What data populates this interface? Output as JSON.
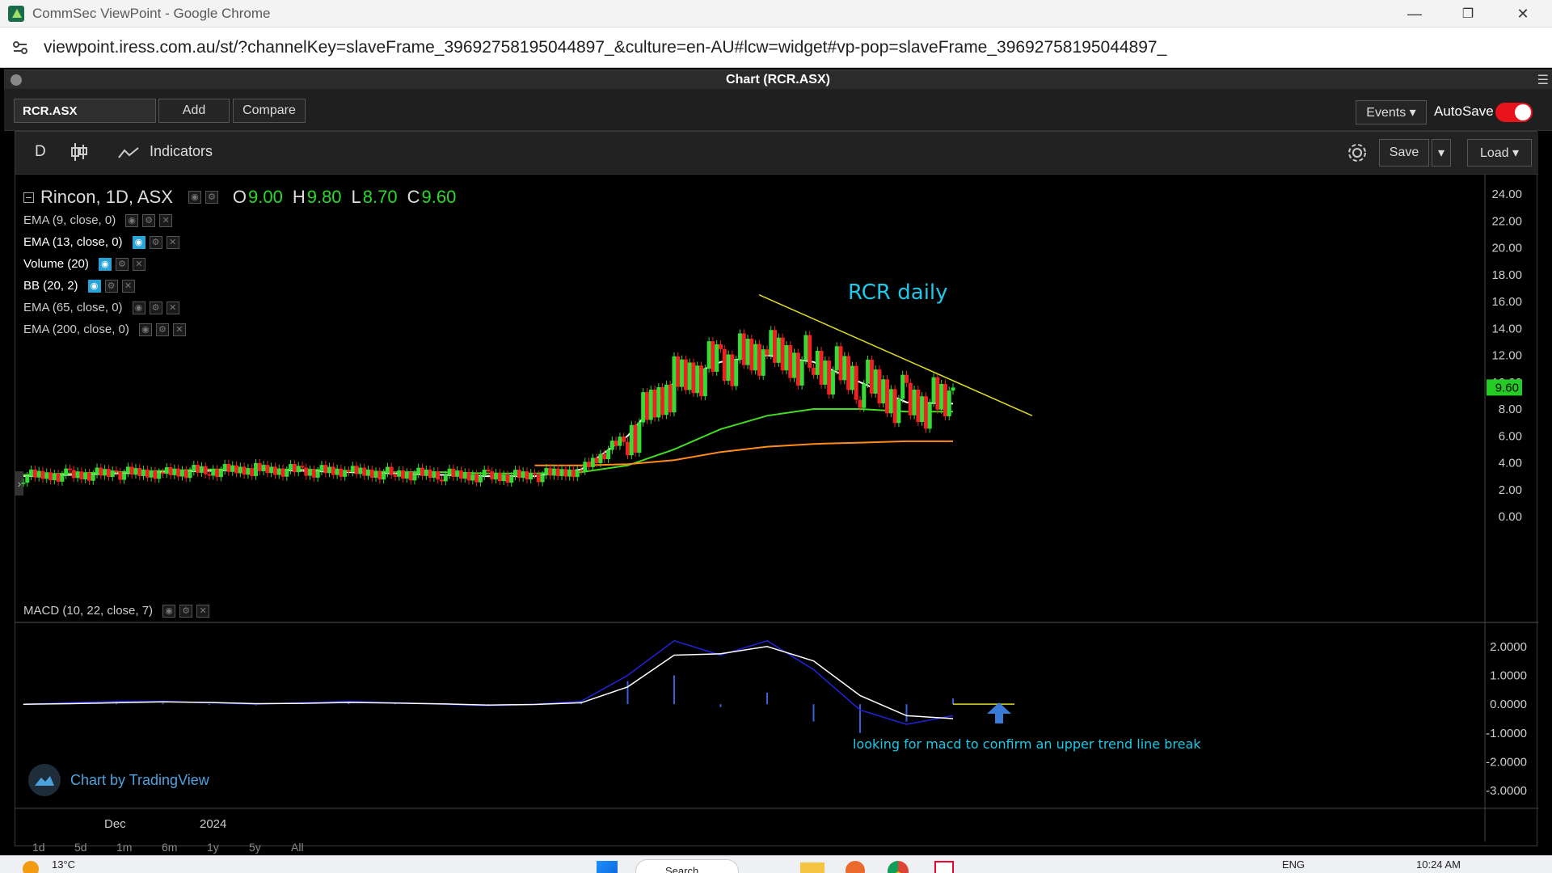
{
  "browser": {
    "window_title": "CommSec ViewPoint - Google Chrome",
    "url": "viewpoint.iress.com.au/st/?channelKey=slaveFrame_39692758195044897_&culture=en-AU#lcw=widget#vp-pop=slaveFrame_39692758195044897_",
    "minimize_glyph": "—",
    "restore_glyph": "❐",
    "close_glyph": "✕"
  },
  "panel": {
    "title": "Chart (RCR.ASX)"
  },
  "toolbar": {
    "symbol": "RCR.ASX",
    "add_label": "Add",
    "compare_label": "Compare",
    "events_label": "Events ▾",
    "autosave_label": "AutoSave",
    "autosave_on": true
  },
  "chart_toolbar": {
    "interval": "D",
    "indicators_label": "Indicators",
    "save_label": "Save",
    "save_dropdown": "▾",
    "load_label": "Load ▾"
  },
  "legend": {
    "main": "Rincon, 1D, ASX",
    "o_key": "O",
    "o_val": "9.00",
    "h_key": "H",
    "h_val": "9.80",
    "l_key": "L",
    "l_val": "8.70",
    "c_key": "C",
    "c_val": "9.60",
    "studies": [
      "EMA (9, close, 0)",
      "EMA (13, close, 0)",
      "Volume (20)",
      "BB (20, 2)",
      "EMA (65, close, 0)",
      "EMA (200, close, 0)"
    ],
    "macd": "MACD (10, 22, close, 7)"
  },
  "annotations": {
    "title": "RCR daily",
    "note": "looking for macd to confirm an upper trend line break",
    "watermark": "Chart by TradingView"
  },
  "price_axis": {
    "labels": [
      "24.00",
      "22.00",
      "20.00",
      "18.00",
      "16.00",
      "14.00",
      "12.00",
      "10.00",
      "8.00",
      "6.00",
      "4.00",
      "2.00",
      "0.00"
    ],
    "last_price": "9.60"
  },
  "macd_axis": {
    "labels": [
      "2.0000",
      "1.0000",
      "0.0000",
      "-1.0000",
      "-2.0000",
      "-3.0000"
    ]
  },
  "time_axis": {
    "labels": [
      "Dec",
      "2024"
    ]
  },
  "ranges": [
    "1d",
    "5d",
    "1m",
    "6m",
    "1y",
    "5y",
    "All"
  ],
  "colors": {
    "up": "#33dd33",
    "down": "#ee2222",
    "ema_fast": "#ffffff",
    "ema_mid": "#44dd22",
    "ema_slow": "#ff8c1a",
    "trendline": "#dddd22",
    "macd_line": "#2222dd",
    "signal_line": "#ffffff",
    "annotation": "#1ec8e6"
  },
  "chart_data": {
    "type": "line",
    "symbol": "Rincon, 1D, ASX",
    "ylim": [
      0,
      24
    ],
    "ohlc_last": {
      "open": 9.0,
      "high": 9.8,
      "low": 8.7,
      "close": 9.6
    },
    "series": [
      {
        "name": "EMA (9, close, 0)",
        "values": [
          3.0,
          3.1,
          3.2,
          3.3,
          3.4,
          3.5,
          3.4,
          3.3,
          3.2,
          3.1,
          3.0,
          3.0,
          3.5,
          6.0,
          10.0,
          11.5,
          12.0,
          11.5,
          10.0,
          8.5,
          8.4
        ]
      },
      {
        "name": "EMA (65, close, 0)",
        "values": [
          3.1,
          3.2,
          3.3,
          3.4,
          3.5,
          3.5,
          3.5,
          3.4,
          3.3,
          3.3,
          3.2,
          3.2,
          3.3,
          3.8,
          5.0,
          6.5,
          7.5,
          8.0,
          8.0,
          7.8,
          7.8
        ]
      },
      {
        "name": "EMA (200, close, 0)",
        "values": [
          null,
          null,
          null,
          null,
          null,
          null,
          null,
          null,
          null,
          null,
          null,
          3.8,
          3.8,
          3.9,
          4.2,
          4.8,
          5.2,
          5.4,
          5.5,
          5.6,
          5.6
        ]
      }
    ],
    "trendline": {
      "start": 16.5,
      "end": 7.5
    },
    "macd": {
      "ylim": [
        -3,
        2.5
      ],
      "macd_line": [
        0.0,
        0.05,
        0.1,
        0.1,
        0.05,
        0.0,
        0.05,
        0.1,
        0.05,
        0.0,
        -0.05,
        0.0,
        0.1,
        1.0,
        2.2,
        1.7,
        2.2,
        1.2,
        -0.2,
        -0.7,
        -0.4
      ],
      "signal_line": [
        0.0,
        0.02,
        0.05,
        0.08,
        0.06,
        0.02,
        0.03,
        0.06,
        0.04,
        0.01,
        -0.03,
        -0.01,
        0.05,
        0.6,
        1.7,
        1.75,
        2.0,
        1.5,
        0.3,
        -0.4,
        -0.5
      ]
    }
  },
  "taskbar": {
    "weather": "13°C",
    "search": "Search",
    "lang": "ENG",
    "time": "10:24 AM"
  }
}
